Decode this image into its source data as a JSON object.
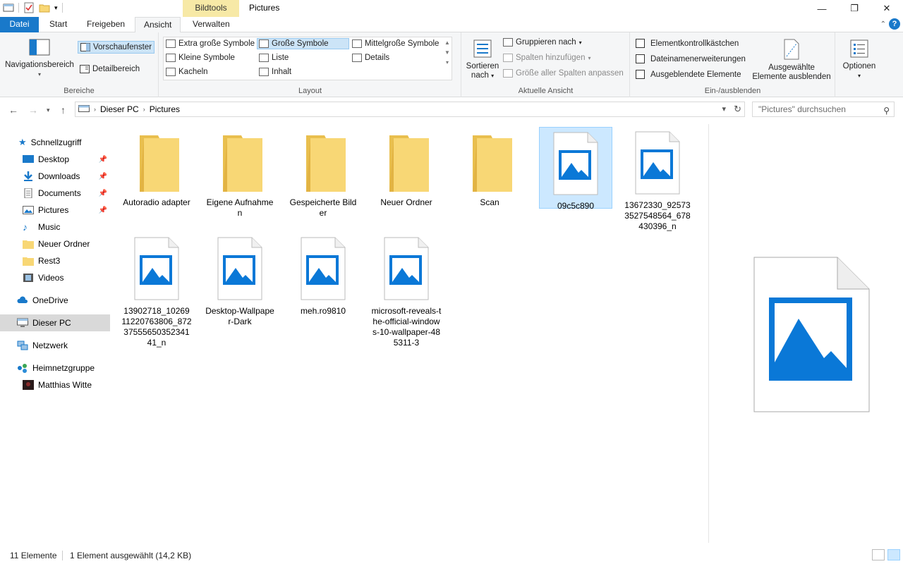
{
  "window": {
    "contextual_tab": "Bildtools",
    "title": "Pictures",
    "minimize": "—",
    "maximize": "❐",
    "close": "✕"
  },
  "tabs": [
    {
      "label": "Datei"
    },
    {
      "label": "Start"
    },
    {
      "label": "Freigeben"
    },
    {
      "label": "Ansicht"
    },
    {
      "label": "Verwalten"
    }
  ],
  "ribbon": {
    "bereiche": {
      "label": "Bereiche",
      "navigation": "Navigationsbereich",
      "preview": "Vorschaufenster",
      "details": "Detailbereich"
    },
    "layout": {
      "label": "Layout",
      "items": [
        "Extra große Symbole",
        "Große Symbole",
        "Mittelgroße Symbole",
        "Kleine Symbole",
        "Liste",
        "Details",
        "Kacheln",
        "Inhalt"
      ]
    },
    "aktuelle_ansicht": {
      "label": "Aktuelle Ansicht",
      "sort": "Sortieren",
      "sort2": "nach",
      "group": "Gruppieren nach",
      "add_cols": "Spalten hinzufügen",
      "fit_cols": "Größe aller Spalten anpassen"
    },
    "einaus": {
      "label": "Ein-/ausblenden",
      "chk1": "Elementkontrollkästchen",
      "chk2": "Dateinamenerweiterungen",
      "chk3": "Ausgeblendete Elemente",
      "hide1": "Ausgewählte",
      "hide2": "Elemente ausblenden"
    },
    "optionen": {
      "label": "Optionen"
    }
  },
  "address": {
    "crumbs": [
      "Dieser PC",
      "Pictures"
    ],
    "search_placeholder": "\"Pictures\" durchsuchen"
  },
  "nav": {
    "quick": "Schnellzugriff",
    "items": [
      "Desktop",
      "Downloads",
      "Documents",
      "Pictures",
      "Music",
      "Neuer Ordner",
      "Rest3",
      "Videos"
    ],
    "onedrive": "OneDrive",
    "thispc": "Dieser PC",
    "network": "Netzwerk",
    "homegroup": "Heimnetzgruppe",
    "user": "Matthias Witte"
  },
  "files": [
    {
      "name": "Autoradio adapter",
      "type": "folder"
    },
    {
      "name": "Eigene Aufnahmen",
      "type": "folder"
    },
    {
      "name": "Gespeicherte Bilder",
      "type": "folder"
    },
    {
      "name": "Neuer Ordner",
      "type": "folder"
    },
    {
      "name": "Scan",
      "type": "folder"
    },
    {
      "name": "09c5c890",
      "type": "image",
      "selected": true
    },
    {
      "name": "13672330_925733527548564_678430396_n",
      "type": "image"
    },
    {
      "name": "13902718_1026911220763806_8723755565035234141_n",
      "type": "image"
    },
    {
      "name": "Desktop-Wallpaper-Dark",
      "type": "image"
    },
    {
      "name": "meh.ro9810",
      "type": "image"
    },
    {
      "name": "microsoft-reveals-the-official-windows-10-wallpaper-485311-3",
      "type": "image"
    }
  ],
  "status": {
    "count": "11 Elemente",
    "selection": "1 Element ausgewählt (14,2 KB)"
  },
  "colors": {
    "accent": "#1979ca",
    "folder": "#f8d775",
    "image_blue": "#0a78d7",
    "selection": "#cce8ff"
  }
}
